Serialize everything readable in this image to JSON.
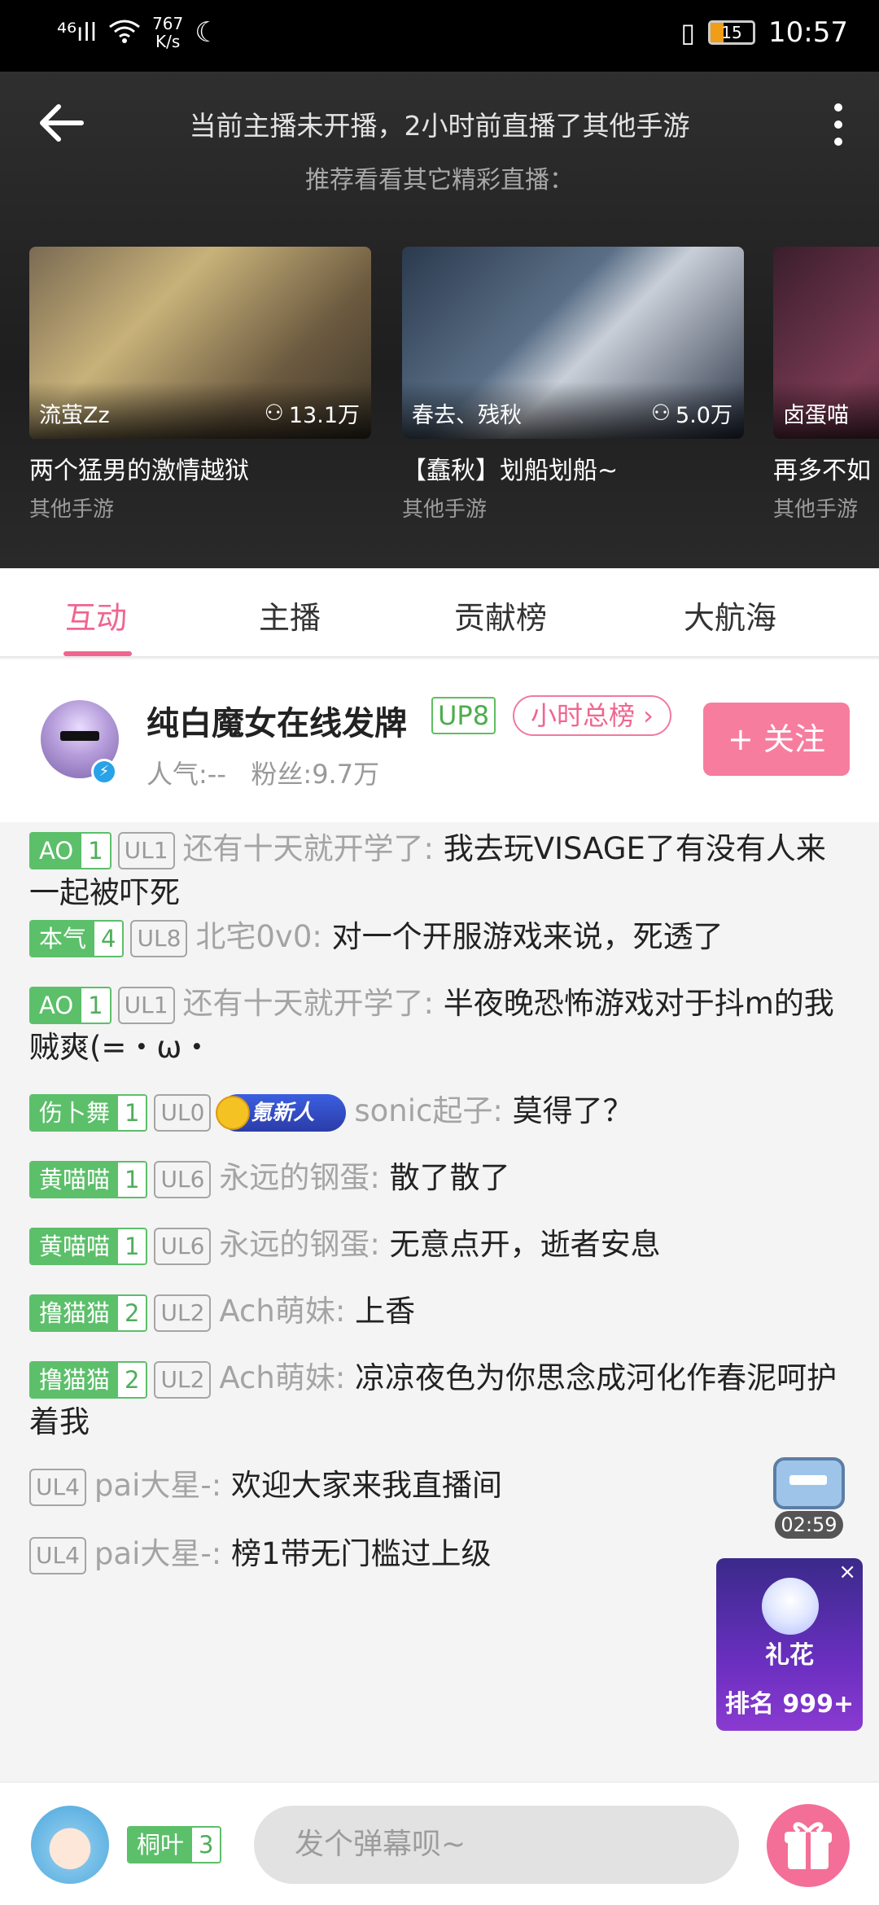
{
  "status_bar": {
    "signal": "⁴⁶ıll",
    "net_speed_value": "767",
    "net_speed_unit": "K/s",
    "battery": "15",
    "time": "10:57"
  },
  "header": {
    "notice_main": "当前主播未开播，2小时前直播了其他手游",
    "notice_sub": "推荐看看其它精彩直播：",
    "cards": [
      {
        "anchor": "流萤Zz",
        "views": "13.1万",
        "title": "两个猛男的激情越狱",
        "category": "其他手游"
      },
      {
        "anchor": "春去、残秋",
        "views": "5.0万",
        "title": "【蠢秋】划船划船~",
        "category": "其他手游"
      },
      {
        "anchor": "卤蛋喵",
        "views": "",
        "title": "再多不如",
        "category": "其他手游"
      }
    ]
  },
  "tabs": [
    {
      "label": "互动",
      "active": true
    },
    {
      "label": "主播",
      "active": false
    },
    {
      "label": "贡献榜",
      "active": false
    },
    {
      "label": "大航海",
      "active": false
    }
  ],
  "streamer": {
    "name": "纯白魔女在线发牌",
    "up_level": "UP8",
    "rank_pill": "小时总榜 ›",
    "popularity": "人气:--",
    "fans": "粉丝:9.7万",
    "follow_label": "+ 关注"
  },
  "chat": [
    {
      "medal_name": "AO",
      "medal_level": "1",
      "ul": "UL1",
      "user": "还有十天就开学了:",
      "text": " 我去玩VISAGE了有没有人来一起被吓死"
    },
    {
      "medal_name": "本气",
      "medal_level": "4",
      "ul": "UL8",
      "user": "北宅0v0:",
      "text": " 对一个开服游戏来说，死透了"
    },
    {
      "medal_name": "AO",
      "medal_level": "1",
      "ul": "UL1",
      "user": "还有十天就开学了:",
      "text": " 半夜晚恐怖游戏对于抖m的我贼爽(=・ω・"
    },
    {
      "medal_name": "伤卜舞",
      "medal_level": "1",
      "ul": "UL0",
      "badge": "氪新人",
      "user": "sonic起子:",
      "text": " 莫得了？"
    },
    {
      "medal_name": "黄喵喵",
      "medal_level": "1",
      "ul": "UL6",
      "user": "永远的钢蛋:",
      "text": " 散了散了"
    },
    {
      "medal_name": "黄喵喵",
      "medal_level": "1",
      "ul": "UL6",
      "user": "永远的钢蛋:",
      "text": " 无意点开，逝者安息"
    },
    {
      "medal_name": "撸猫猫",
      "medal_level": "2",
      "ul": "UL2",
      "user": "Ach萌妹:",
      "text": " 上香"
    },
    {
      "medal_name": "撸猫猫",
      "medal_level": "2",
      "ul": "UL2",
      "user": "Ach萌妹:",
      "text": " 凉凉夜色为你思念成河化作春泥呵护着我"
    },
    {
      "ul": "UL4",
      "user": "pai大星-:",
      "text": " 欢迎大家来我直播间"
    },
    {
      "ul": "UL4",
      "user": "pai大星-:",
      "text": " 榜1带无门槛过上级"
    }
  ],
  "chest": {
    "timer": "02:59"
  },
  "gift_banner": {
    "title": "礼花",
    "rank": "排名 999+",
    "close": "×"
  },
  "bottom_bar": {
    "medal_name": "桐叶",
    "medal_level": "3",
    "input_placeholder": "发个弹幕呗~"
  },
  "colors": {
    "accent": "#f06590",
    "medal_green": "#5cbf6a",
    "follow": "#f77d9f"
  }
}
